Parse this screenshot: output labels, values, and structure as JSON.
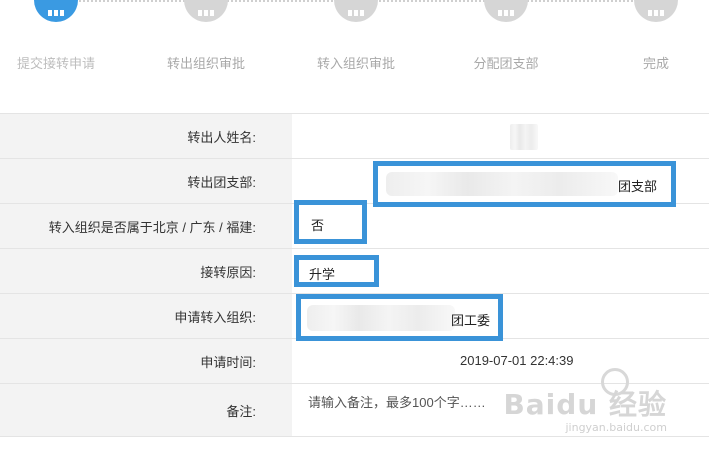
{
  "stepper": {
    "steps": [
      {
        "label": "提交接转申请",
        "state": "active"
      },
      {
        "label": "转出组织审批",
        "state": "pending"
      },
      {
        "label": "转入组织审批",
        "state": "pending"
      },
      {
        "label": "分配团支部",
        "state": "pending"
      },
      {
        "label": "完成",
        "state": "pending"
      }
    ]
  },
  "form": {
    "rows": [
      {
        "label": "转出人姓名:",
        "value": ""
      },
      {
        "label": "转出团支部:",
        "value": "团支部"
      },
      {
        "label": "转入组织是否属于北京 / 广东 / 福建:",
        "value": "否"
      },
      {
        "label": "接转原因:",
        "value": "升学"
      },
      {
        "label": "申请转入组织:",
        "value": "团工委"
      },
      {
        "label": "申请时间:",
        "value": "2019-07-01 22:4:39"
      },
      {
        "label": "备注:",
        "placeholder": "请输入备注，最多100个字……"
      }
    ]
  },
  "watermark": {
    "main": "Baidu 经验",
    "sub": "jingyan.baidu.com"
  },
  "colors": {
    "accent": "#3a9ae2",
    "highlight_border": "#3a93d8",
    "label_bg": "#f3f3f3"
  }
}
